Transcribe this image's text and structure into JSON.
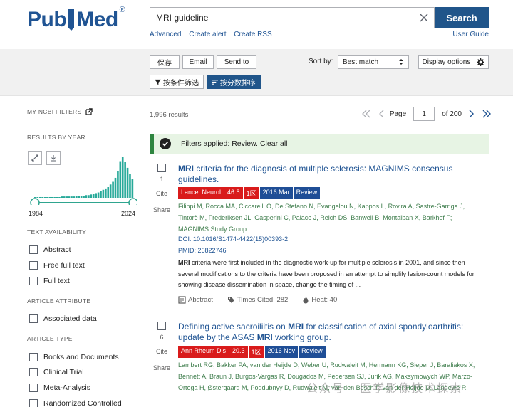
{
  "header": {
    "logo_pub": "Pub",
    "logo_med": "Med",
    "logo_reg": "®",
    "search_value": "MRI guideline",
    "search_button": "Search",
    "links": [
      "Advanced",
      "Create alert",
      "Create RSS"
    ],
    "user_guide": "User Guide"
  },
  "toolbar": {
    "save": "保存",
    "email": "Email",
    "send_to": "Send to",
    "sort_label": "Sort by:",
    "sort_value": "Best match",
    "display_options": "Display options",
    "filter_btn": "按条件筛选",
    "sort_score_btn": "按分数排序"
  },
  "sidebar": {
    "my_ncbi_filters": "MY NCBI FILTERS",
    "results_by_year": "RESULTS BY YEAR",
    "year_start": "1984",
    "year_end": "2024",
    "text_availability": "TEXT AVAILABILITY",
    "text_items": [
      "Abstract",
      "Free full text",
      "Full text"
    ],
    "article_attribute": "ARTICLE ATTRIBUTE",
    "attribute_items": [
      "Associated data"
    ],
    "article_type": "ARTICLE TYPE",
    "type_items": [
      "Books and Documents",
      "Clinical Trial",
      "Meta-Analysis",
      "Randomized Controlled"
    ],
    "histogram": [
      1,
      1,
      1,
      1,
      1,
      1,
      1,
      1,
      1,
      1,
      1,
      2,
      2,
      2,
      2,
      2,
      2,
      3,
      3,
      3,
      3,
      4,
      4,
      5,
      6,
      7,
      8,
      10,
      12,
      14,
      16,
      20,
      24,
      30,
      40,
      55,
      62,
      54,
      45,
      36,
      28
    ]
  },
  "main": {
    "results_count": "1,996 results",
    "page_label": "Page",
    "page_value": "1",
    "page_of": "of 200",
    "filters_text": "Filters applied: Review.",
    "clear_all": "Clear all",
    "results": [
      {
        "num": "1",
        "title_prefix": "MRI",
        "title_rest": " criteria for the diagnosis of multiple sclerosis: MAGNIMS consensus guidelines.",
        "journal": "Lancet Neurol",
        "impact": "46.5",
        "zone": "1区",
        "date": "2016 Mar",
        "type": "Review",
        "authors": "Filippi M, Rocca MA, Ciccarelli O, De Stefano N, Evangelou N, Kappos L, Rovira A, Sastre-Garriga J, Tintorè M, Frederiksen JL, Gasperini C, Palace J, Reich DS, Banwell B, Montalban X, Barkhof F; MAGNIMS Study Group.",
        "doi": "DOI: 10.1016/S1474-4422(15)00393-2",
        "pmid": "PMID: 26822746",
        "snippet_bold": "MRI",
        "snippet": " criteria were first included in the diagnostic work-up for multiple sclerosis in 2001, and since then several modifications to the criteria have been proposed in an attempt to simplify lesion-count models for showing disease dissemination in space, change the timing of ...",
        "abstract": "Abstract",
        "times_cited": "Times Cited: 282",
        "heat": "Heat: 40"
      },
      {
        "num": "6",
        "title_a": "Defining active sacroiliitis on ",
        "title_b": "MRI",
        "title_c": " for classification of axial spondyloarthritis: update by the ASAS ",
        "title_d": "MRI",
        "title_e": " working group.",
        "journal": "Ann Rheum Dis",
        "impact": "20.3",
        "zone": "1区",
        "date": "2016 Nov",
        "type": "Review",
        "authors": "Lambert RG, Bakker PA, van der Heijde D, Weber U, Rudwaleit M, Hermann KG, Sieper J, Baraliakos X, Bennett A, Braun J, Burgos-Vargas R, Dougados M, Pedersen SJ, Jurik AG, Maksymowych WP, Marzo-Ortega H, Østergaard M, Poddubnyy D, Rudwaleit M, van den Bosch F, van der Heijde D, Landewé R."
      }
    ],
    "cite": "Cite",
    "share": "Share"
  },
  "watermark": "公众号 · 医学影像技术探索",
  "colors": {
    "brand": "#205493",
    "search_button": "#20558a",
    "badge_red": "#d91b1b",
    "badge_blue": "#1f4e96",
    "authors": "#3d7c4b",
    "banner": "#e7f4e4"
  }
}
